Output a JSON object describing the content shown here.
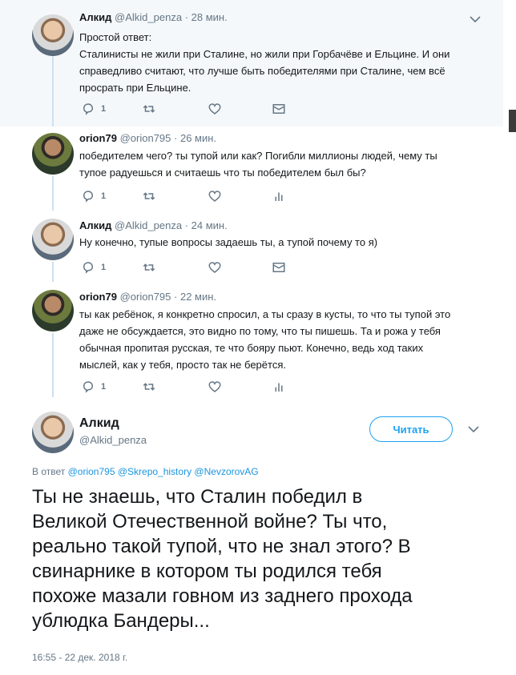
{
  "thread": [
    {
      "name": "Алкид",
      "handle": "@Alkid_penza",
      "sep": "·",
      "time": "28 мин.",
      "lines": [
        "Простой ответ:",
        "Сталинисты не жили при Сталине, но жили при Горбачёве и Ельцине. И они",
        "справедливо считают, что лучше быть победителями при Сталине, чем всё",
        "просрать при Ельцине."
      ],
      "reply_count": "1",
      "last_action_icon": "envelope-icon"
    },
    {
      "name": "orion79",
      "handle": "@orion795",
      "sep": "·",
      "time": "26 мин.",
      "lines": [
        "победителем чего? ты тупой или как? Погибли миллионы людей, чему ты",
        "тупое радуешься и считаешь что ты победителем был бы?"
      ],
      "reply_count": "1",
      "last_action_icon": "analytics-icon"
    },
    {
      "name": "Алкид",
      "handle": "@Alkid_penza",
      "sep": "·",
      "time": "24 мин.",
      "lines": [
        "Ну конечно, тупые вопросы задаешь ты, а тупой почему то я)"
      ],
      "reply_count": "1",
      "last_action_icon": "envelope-icon"
    },
    {
      "name": "orion79",
      "handle": "@orion795",
      "sep": "·",
      "time": "22 мин.",
      "lines": [
        "ты как ребёнок, я конкретно спросил, а ты сразу в кусты, то что ты тупой это",
        "даже не обсуждается, это видно по тому, что ты пишешь. Та и рожа у тебя",
        "обычная пропитая русская, те что бояру пьют. Конечно, ведь ход таких",
        "мыслей, как у тебя, просто так не берётся."
      ],
      "reply_count": "1",
      "last_action_icon": "analytics-icon"
    }
  ],
  "main_tweet": {
    "name": "Алкид",
    "handle": "@Alkid_penza",
    "follow_label": "Читать",
    "reply_prefix": "В ответ",
    "mentions": [
      "@orion795",
      "@Skrepo_history",
      "@NevzorovAG"
    ],
    "text_lines": [
      "Ты не знаешь, что Сталин победил в",
      "Великой Отечественной войне?  Ты что,",
      "реально такой тупой, что не  знал этого? В",
      "свинарнике в котором ты родился тебя",
      "похоже мазали говном из заднего прохода",
      "ублюдка Бандеры..."
    ],
    "timestamp": "16:55 - 22 дек. 2018 г."
  },
  "icons": {
    "reply": "reply-icon",
    "retweet": "retweet-icon",
    "like": "heart-icon",
    "more": "chevron-down-icon"
  },
  "colors": {
    "accent": "#1da1f2",
    "muted": "#657786",
    "thread_bg": "#f5f8fa",
    "thread_line": "#cce0f0"
  }
}
